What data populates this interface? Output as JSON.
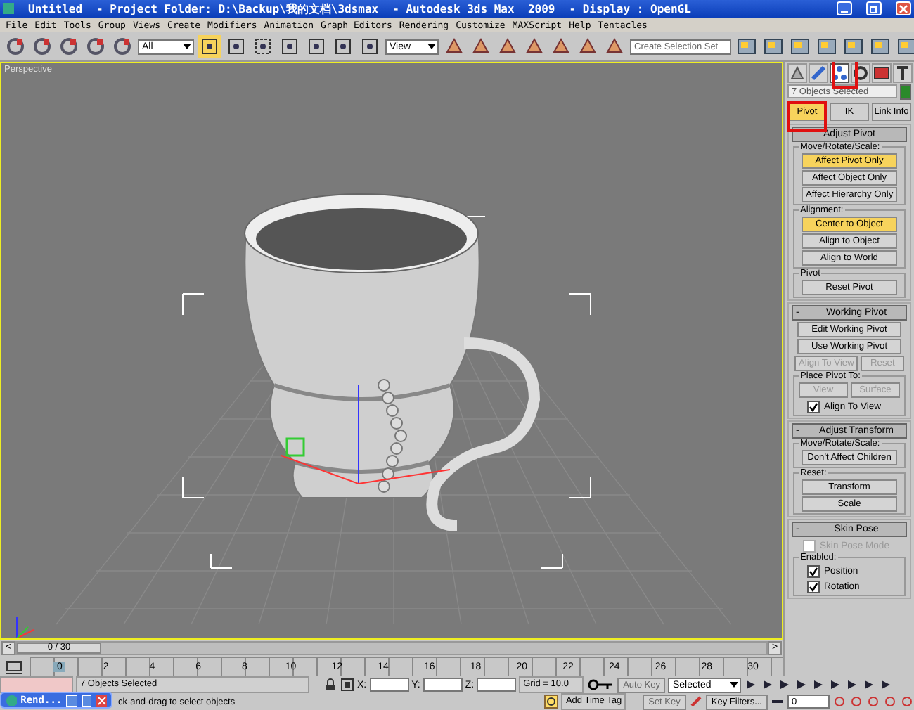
{
  "window": {
    "title_parts": [
      "Untitled",
      "- Project Folder: D:\\Backup\\我的文档\\3dsmax",
      "- Autodesk 3ds Max  2009",
      "- Display : OpenGL"
    ]
  },
  "menu": [
    "File",
    "Edit",
    "Tools",
    "Group",
    "Views",
    "Create",
    "Modifiers",
    "Animation",
    "Graph Editors",
    "Rendering",
    "Customize",
    "MAXScript",
    "Help",
    "Tentacles"
  ],
  "toolbar": {
    "selection_filter": "All",
    "reference_coordinate": "View",
    "named_selection": {
      "placeholder": "Create Selection Set"
    }
  },
  "viewport": {
    "label": "Perspective"
  },
  "command_panel": {
    "tabs": [
      {
        "kind": "create",
        "selected": false
      },
      {
        "kind": "modify",
        "selected": false
      },
      {
        "kind": "hierarchy",
        "selected": true
      },
      {
        "kind": "motion",
        "selected": false
      },
      {
        "kind": "display",
        "selected": false
      },
      {
        "kind": "utilities",
        "selected": false
      }
    ],
    "name_field": "7 Objects Selected",
    "subtabs": [
      {
        "label": "Pivot",
        "selected": true
      },
      {
        "label": "IK",
        "selected": false
      },
      {
        "label": "Link Info",
        "selected": false
      }
    ],
    "rollouts": [
      {
        "title": "Adjust Pivot",
        "items": [
          {
            "kind": "group",
            "title": "Move/Rotate/Scale:",
            "items": [
              {
                "kind": "button",
                "label": "Affect Pivot Only",
                "selected": true,
                "disabled": false
              },
              {
                "kind": "button",
                "label": "Affect Object Only",
                "selected": false,
                "disabled": false
              },
              {
                "kind": "button",
                "label": "Affect Hierarchy Only",
                "selected": false,
                "disabled": false
              }
            ]
          },
          {
            "kind": "group",
            "title": "Alignment:",
            "items": [
              {
                "kind": "button",
                "label": "Center to Object",
                "selected": true,
                "disabled": false
              },
              {
                "kind": "button",
                "label": "Align to Object",
                "selected": false,
                "disabled": false
              },
              {
                "kind": "button",
                "label": "Align to World",
                "selected": false,
                "disabled": false
              }
            ]
          },
          {
            "kind": "group",
            "title": "Pivot",
            "items": [
              {
                "kind": "button",
                "label": "Reset Pivot",
                "selected": false,
                "disabled": false
              }
            ]
          }
        ]
      },
      {
        "title": "Working Pivot",
        "sign": "-",
        "items": [
          {
            "kind": "button",
            "label": "Edit Working Pivot",
            "selected": false,
            "disabled": false
          },
          {
            "kind": "button",
            "label": "Use Working Pivot",
            "selected": false,
            "disabled": false
          },
          {
            "kind": "row",
            "buttons": [
              {
                "label": "Align To View",
                "disabled": true
              },
              {
                "label": "Reset",
                "disabled": true
              }
            ]
          },
          {
            "kind": "group",
            "title": "Place Pivot To:",
            "items": [
              {
                "kind": "row",
                "buttons": [
                  {
                    "label": "View",
                    "disabled": true
                  },
                  {
                    "label": "Surface",
                    "disabled": true
                  }
                ]
              },
              {
                "kind": "checkbox",
                "label": "Align To View",
                "checked": true,
                "disabled": false
              }
            ]
          }
        ]
      },
      {
        "title": "Adjust Transform",
        "sign": "-",
        "items": [
          {
            "kind": "group",
            "title": "Move/Rotate/Scale:",
            "items": [
              {
                "kind": "button",
                "label": "Don't Affect Children",
                "selected": false,
                "disabled": false
              }
            ]
          },
          {
            "kind": "group",
            "title": "Reset:",
            "items": [
              {
                "kind": "button",
                "label": "Transform",
                "selected": false,
                "disabled": false
              },
              {
                "kind": "button",
                "label": "Scale",
                "selected": false,
                "disabled": false
              }
            ]
          }
        ]
      },
      {
        "title": "Skin Pose",
        "sign": "-",
        "items": [
          {
            "kind": "checkbox",
            "label": "Skin Pose Mode",
            "checked": false,
            "disabled": true
          },
          {
            "kind": "group",
            "title": "Enabled:",
            "items": [
              {
                "kind": "checkbox",
                "label": "Position",
                "checked": true,
                "disabled": false
              },
              {
                "kind": "checkbox",
                "label": "Rotation",
                "checked": true,
                "disabled": false
              }
            ]
          }
        ]
      }
    ]
  },
  "timeline": {
    "prev": "<",
    "frame": "0 / 30",
    "next": ">",
    "level": 0
  },
  "track_bar": {
    "ticks": [
      {
        "label": "0",
        "selected": true
      },
      {
        "label": "2",
        "selected": false
      },
      {
        "label": "4",
        "selected": false
      },
      {
        "label": "6",
        "selected": false
      },
      {
        "label": "8",
        "selected": false
      },
      {
        "label": "10",
        "selected": false
      },
      {
        "label": "12",
        "selected": false
      },
      {
        "label": "14",
        "selected": false
      },
      {
        "label": "16",
        "selected": false
      },
      {
        "label": "18",
        "selected": false
      },
      {
        "label": "20",
        "selected": false
      },
      {
        "label": "22",
        "selected": false
      },
      {
        "label": "24",
        "selected": false
      },
      {
        "label": "26",
        "selected": false
      },
      {
        "label": "28",
        "selected": false
      },
      {
        "label": "30",
        "selected": false
      }
    ]
  },
  "status": {
    "selection": "7 Objects Selected",
    "prompt": "ck-and-drag to select objects",
    "x_label": "X:",
    "y_label": "Y:",
    "z_label": "Z:",
    "grid": "Grid = 10.0",
    "add_time_tag": "Add Time Tag",
    "auto_key": "Auto Key",
    "set_key": "Set Key",
    "key_set": "Selected",
    "key_filters": "Key Filters...",
    "frame": "0"
  },
  "taskbar_popup": {
    "label": "Rend..."
  }
}
